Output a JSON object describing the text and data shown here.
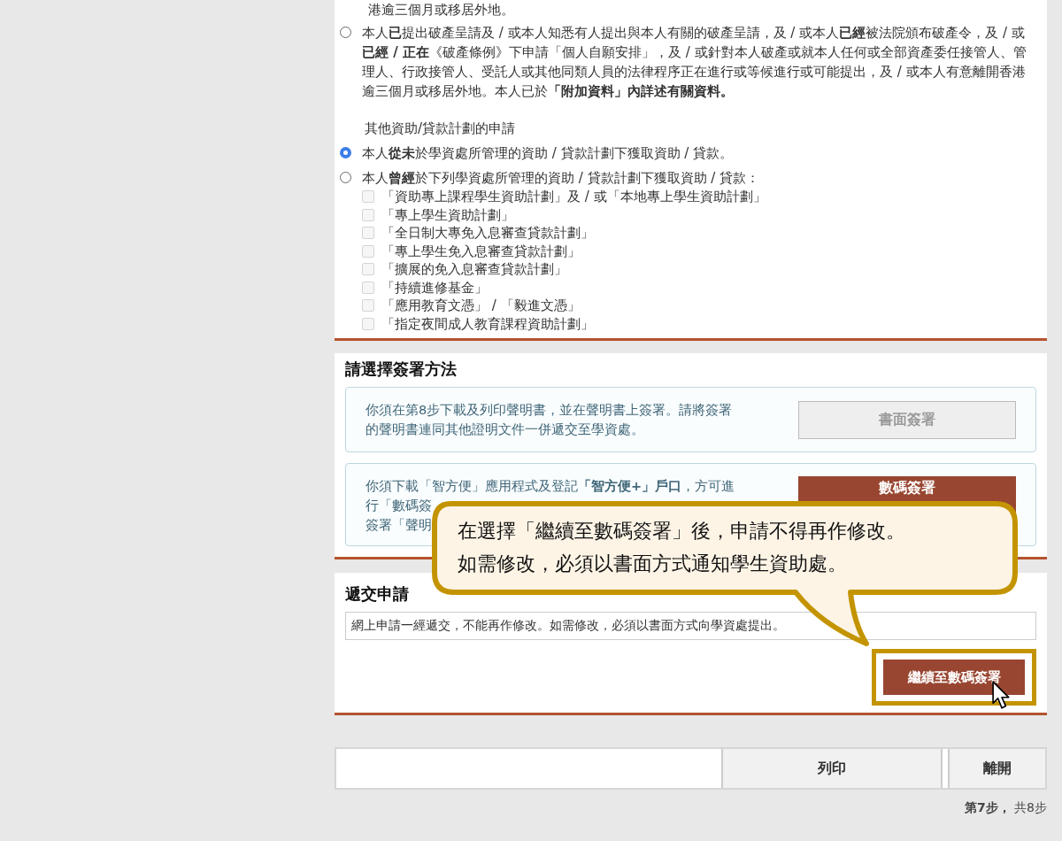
{
  "bankruptcy": {
    "top_fragment": "港逾三個月或移居外地。",
    "option": {
      "text": "本人**已**提出破產呈請及 / 或本人知悉有人提出與本人有關的破產呈請，及 / 或本人**已經**被法院頒布破產令，及 / 或**已經 / 正在**《破產條例》下申請「個人自願安排」，及 / 或針對本人破產或就本人任何或全部資產委任接管人、管理人、行政接管人、受託人或其他同類人員的法律程序正在進行或等候進行或可能提出，及 / 或本人有意離開香港逾三個月或移居外地。本人已於**「附加資料」內詳述有關資料。**",
      "selected": false
    }
  },
  "other_schemes": {
    "heading": "其他資助/貸款計劃的申請",
    "options": [
      {
        "text": "本人**從未**於學資處所管理的資助 / 貸款計劃下獲取資助 / 貸款。",
        "selected": true
      },
      {
        "text": "本人**曾經**於下列學資處所管理的資助 / 貸款計劃下獲取資助 / 貸款：",
        "selected": false,
        "schemes": [
          {
            "label": "「資助專上課程學生資助計劃」及 / 或「本地專上學生資助計劃」",
            "checked": false,
            "disabled": true
          },
          {
            "label": "「專上學生資助計劃」",
            "checked": false,
            "disabled": true
          },
          {
            "label": "「全日制大專免入息審查貸款計劃」",
            "checked": false,
            "disabled": true
          },
          {
            "label": "「專上學生免入息審查貸款計劃」",
            "checked": false,
            "disabled": true
          },
          {
            "label": "「擴展的免入息審查貸款計劃」",
            "checked": false,
            "disabled": true
          },
          {
            "label": "「持續進修基金」",
            "checked": false,
            "disabled": true
          },
          {
            "label": "「應用教育文憑」 / 「毅進文憑」",
            "checked": false,
            "disabled": true
          },
          {
            "label": "「指定夜間成人教育課程資助計劃」",
            "checked": false,
            "disabled": true
          }
        ]
      }
    ]
  },
  "signing": {
    "title": "請選擇簽署方法",
    "methods": [
      {
        "lines": [
          "你須在第8步下載及列印聲明書，並在聲明書上簽署。請將簽署",
          "的聲明書連同其他證明文件一併遞交至學資處。"
        ],
        "button": "書面簽署",
        "disabled": true
      },
      {
        "lines": [
          "你須下載「智方便」應用程式及登記**「智方便+」戶口**，方可進",
          "行「數碼簽",
          "簽署「聲明"
        ],
        "button": "數碼簽署",
        "disabled": false
      }
    ]
  },
  "submit": {
    "title": "遞交申請",
    "notice": "網上申請一經遞交，不能再作修改。如需修改，必須以書面方式向學資處提出。",
    "button": "繼續至數碼簽署",
    "highlighted": true
  },
  "callout": {
    "lines": [
      "在選擇「繼續至數碼簽署」後，申請不得再作修改。",
      "如需修改，必須以書面方式通知學生資助處。"
    ]
  },
  "footer": {
    "buttons": [
      "列印",
      "離開"
    ],
    "step": "**第7步，** 共8步"
  }
}
